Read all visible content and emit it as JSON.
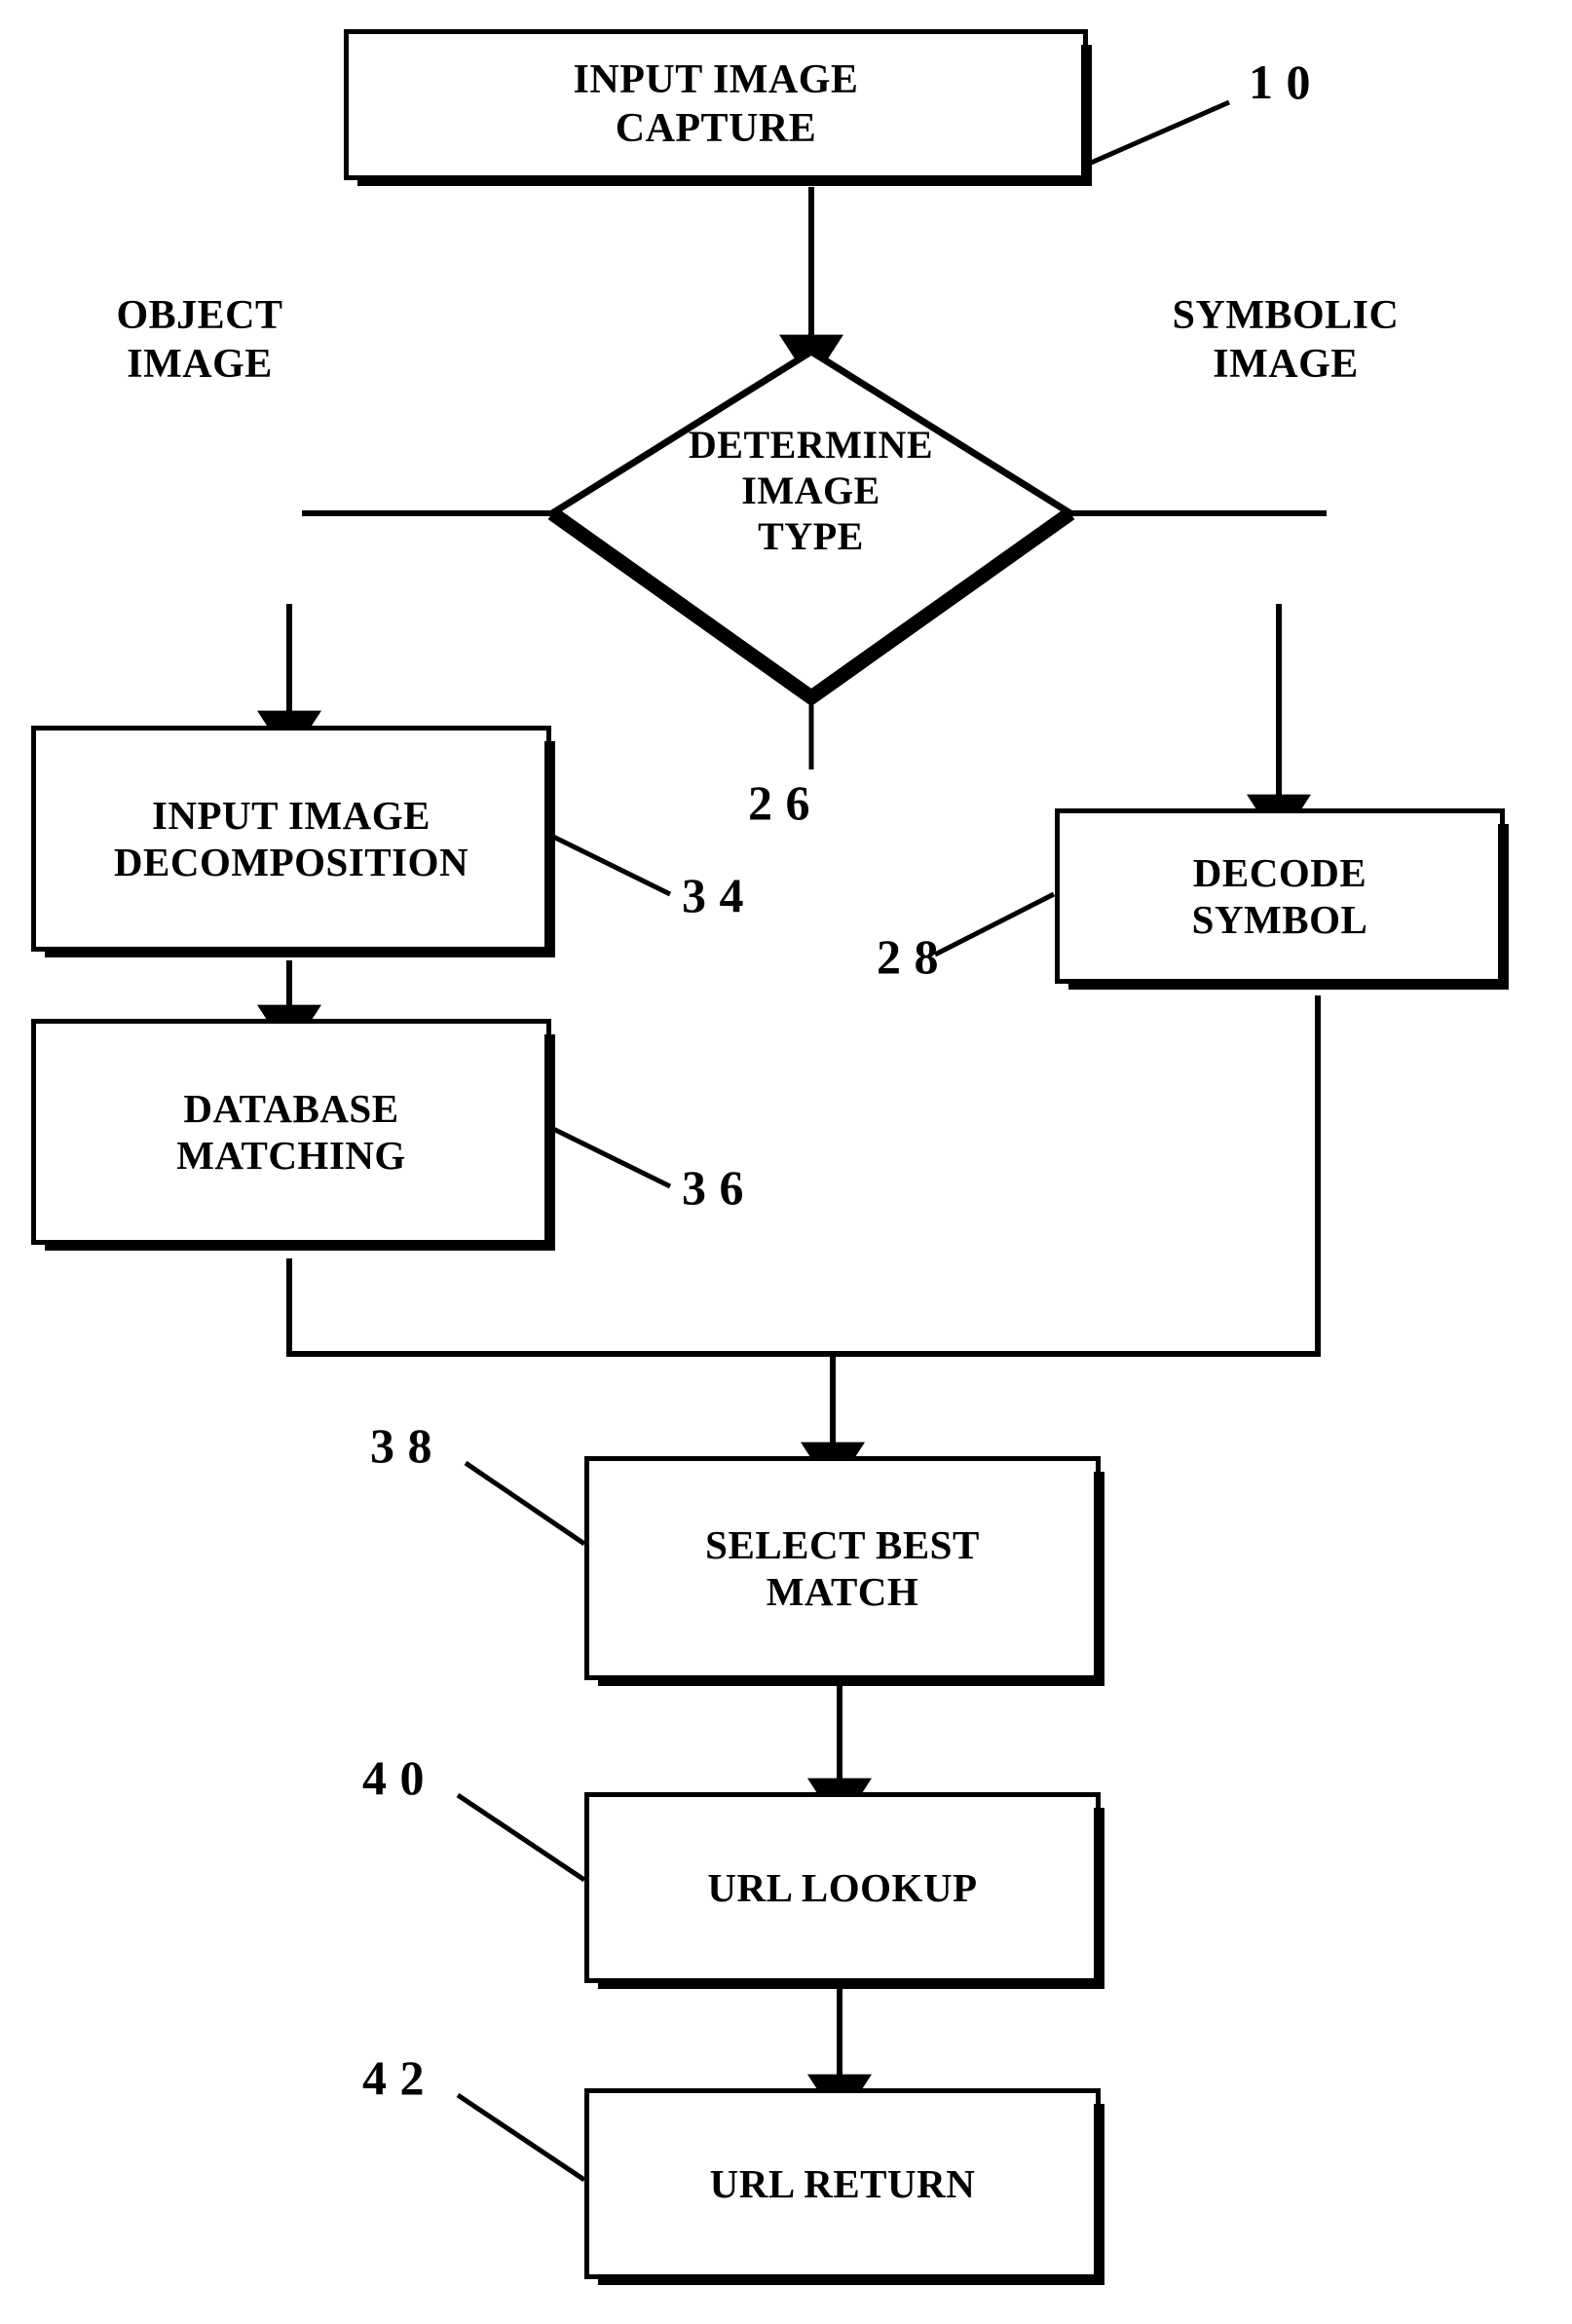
{
  "figure": {
    "kind": "patent-flowchart",
    "background_color": "#ffffff",
    "ink_color": "#000000"
  },
  "nodes": {
    "input_image_capture": {
      "line1": "INPUT IMAGE",
      "line2": "CAPTURE",
      "ref": "1 0"
    },
    "determine_image_type": {
      "line1": "DETERMINE",
      "line2": "IMAGE",
      "line3": "TYPE",
      "ref": "2 6"
    },
    "input_image_decomposition": {
      "line1": "INPUT IMAGE",
      "line2": "DECOMPOSITION",
      "ref": "3 4"
    },
    "database_matching": {
      "line1": "DATABASE",
      "line2": "MATCHING",
      "ref": "3 6"
    },
    "decode_symbol": {
      "line1": "DECODE",
      "line2": "SYMBOL",
      "ref": "2 8"
    },
    "select_best_match": {
      "line1": "SELECT BEST",
      "line2": "MATCH",
      "ref": "3 8"
    },
    "url_lookup": {
      "line1": "URL LOOKUP",
      "line2": "",
      "ref": "4 0"
    },
    "url_return": {
      "line1": "URL RETURN",
      "line2": "",
      "ref": "4 2"
    }
  },
  "branch_labels": {
    "object_image": {
      "line1": "OBJECT",
      "line2": "IMAGE"
    },
    "symbolic_image": {
      "line1": "SYMBOLIC",
      "line2": "IMAGE"
    }
  }
}
